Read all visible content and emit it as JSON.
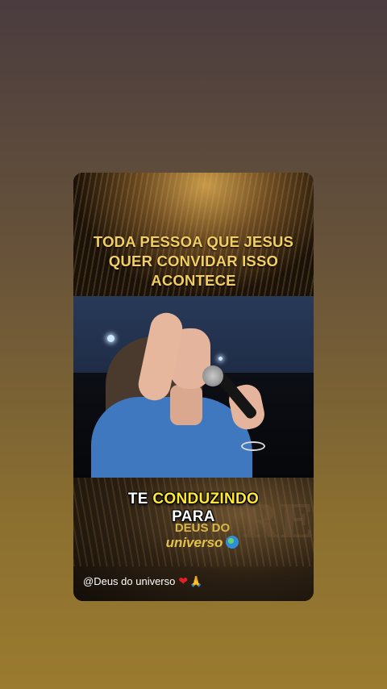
{
  "post": {
    "headline": [
      "TODA PESSOA QUE JESUS",
      "QUER CONVIDAR ISSO",
      "ACONTECE"
    ],
    "caption": {
      "line1_white": "TE ",
      "line1_yellow": "CONDUZINDO",
      "line2": "PARA"
    },
    "logo": {
      "line1": "DEUS DO",
      "line2": "universo"
    },
    "watermark_text": "REI",
    "handle": "@Deus do universo",
    "handle_icons": [
      "heart-icon",
      "pray-icon"
    ]
  },
  "colors": {
    "headline": "#f3cf63",
    "caption_highlight": "#ffe933",
    "caption_white": "#ffffff"
  }
}
